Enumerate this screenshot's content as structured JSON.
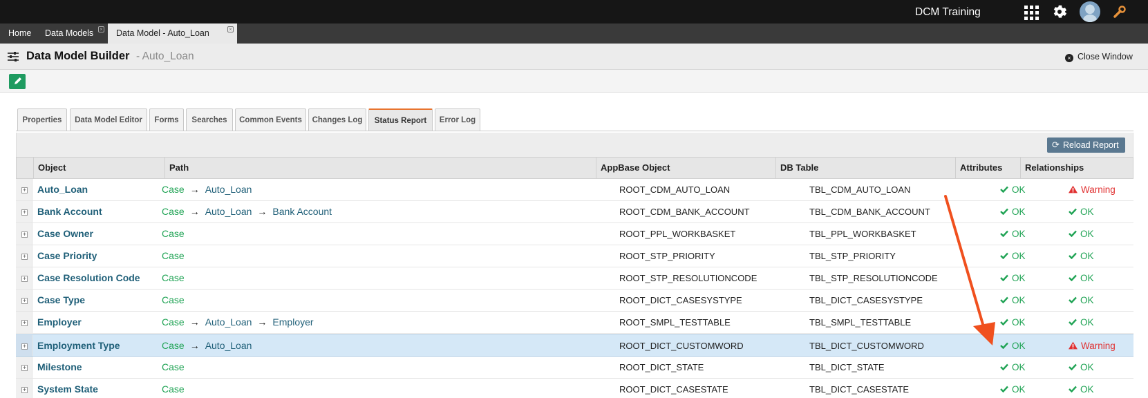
{
  "topbar": {
    "brand": "DCM Training"
  },
  "tabs": [
    {
      "label": "Home"
    },
    {
      "label": "Data Models"
    },
    {
      "label": "Data Model - Auto_Loan"
    }
  ],
  "builder": {
    "title": "Data Model Builder",
    "subtitle": "- Auto_Loan",
    "close_label": "Close Window"
  },
  "panel_tabs": [
    {
      "label": "Properties"
    },
    {
      "label": "Data Model Editor"
    },
    {
      "label": "Forms"
    },
    {
      "label": "Searches"
    },
    {
      "label": "Common Events"
    },
    {
      "label": "Changes Log"
    },
    {
      "label": "Status Report"
    },
    {
      "label": "Error Log"
    }
  ],
  "reload_label": "Reload Report",
  "columns": {
    "object": "Object",
    "path": "Path",
    "appbase": "AppBase Object",
    "db": "DB Table",
    "attributes": "Attributes",
    "relationships": "Relationships"
  },
  "rows": [
    {
      "object": "Auto_Loan",
      "path": [
        "Case",
        "Auto_Loan"
      ],
      "appbase": "ROOT_CDM_AUTO_LOAN",
      "db": "TBL_CDM_AUTO_LOAN",
      "attributes": "OK",
      "relationships": "Warning"
    },
    {
      "object": "Bank Account",
      "path": [
        "Case",
        "Auto_Loan",
        "Bank Account"
      ],
      "appbase": "ROOT_CDM_BANK_ACCOUNT",
      "db": "TBL_CDM_BANK_ACCOUNT",
      "attributes": "OK",
      "relationships": "OK"
    },
    {
      "object": "Case Owner",
      "path": [
        "Case"
      ],
      "appbase": "ROOT_PPL_WORKBASKET",
      "db": "TBL_PPL_WORKBASKET",
      "attributes": "OK",
      "relationships": "OK"
    },
    {
      "object": "Case Priority",
      "path": [
        "Case"
      ],
      "appbase": "ROOT_STP_PRIORITY",
      "db": "TBL_STP_PRIORITY",
      "attributes": "OK",
      "relationships": "OK"
    },
    {
      "object": "Case Resolution Code",
      "path": [
        "Case"
      ],
      "appbase": "ROOT_STP_RESOLUTIONCODE",
      "db": "TBL_STP_RESOLUTIONCODE",
      "attributes": "OK",
      "relationships": "OK"
    },
    {
      "object": "Case Type",
      "path": [
        "Case"
      ],
      "appbase": "ROOT_DICT_CASESYSTYPE",
      "db": "TBL_DICT_CASESYSTYPE",
      "attributes": "OK",
      "relationships": "OK"
    },
    {
      "object": "Employer",
      "path": [
        "Case",
        "Auto_Loan",
        "Employer"
      ],
      "appbase": "ROOT_SMPL_TESTTABLE",
      "db": "TBL_SMPL_TESTTABLE",
      "attributes": "OK",
      "relationships": "OK"
    },
    {
      "object": "Employment Type",
      "path": [
        "Case",
        "Auto_Loan"
      ],
      "appbase": "ROOT_DICT_CUSTOMWORD",
      "db": "TBL_DICT_CUSTOMWORD",
      "attributes": "OK",
      "relationships": "Warning"
    },
    {
      "object": "Milestone",
      "path": [
        "Case"
      ],
      "appbase": "ROOT_DICT_STATE",
      "db": "TBL_DICT_STATE",
      "attributes": "OK",
      "relationships": "OK"
    },
    {
      "object": "System State",
      "path": [
        "Case"
      ],
      "appbase": "ROOT_DICT_CASESTATE",
      "db": "TBL_DICT_CASESTATE",
      "attributes": "OK",
      "relationships": "OK"
    }
  ],
  "colors": {
    "ok": "#1fa354",
    "warning": "#e03030",
    "link": "#1f5f78",
    "annotation_arrow": "#f0501e"
  },
  "icons": [
    "grid-icon",
    "gear-icon",
    "avatar",
    "wrench-icon",
    "sliders-icon",
    "close-icon",
    "pencil-icon",
    "refresh-icon",
    "check-icon",
    "warning-icon",
    "arrow-right-icon"
  ]
}
